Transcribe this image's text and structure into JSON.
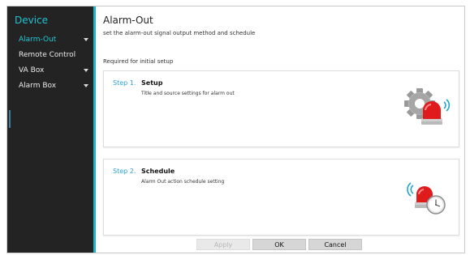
{
  "sidebar": {
    "title": "Device",
    "items": [
      {
        "label": "Alarm-Out",
        "active": true,
        "has_caret": true
      },
      {
        "label": "Remote Control",
        "active": false,
        "has_caret": false
      },
      {
        "label": "VA Box",
        "active": false,
        "has_caret": true
      },
      {
        "label": "Alarm Box",
        "active": false,
        "has_caret": true
      }
    ]
  },
  "header": {
    "title": "Alarm-Out",
    "subtitle": "set the alarm-out signal output method and schedule"
  },
  "section_label": "Required for initial setup",
  "steps": [
    {
      "number": "Step 1.",
      "title": "Setup",
      "description": "Title and source settings for alarm out",
      "icon": "gear-alarm-icon"
    },
    {
      "number": "Step 2.",
      "title": "Schedule",
      "description": "Alarm Out action schedule setting",
      "icon": "alarm-clock-icon"
    }
  ],
  "footer": {
    "apply_label": "Apply",
    "ok_label": "OK",
    "cancel_label": "Cancel"
  },
  "colors": {
    "sidebar_bg": "#232323",
    "accent": "#16b8c9",
    "step_number": "#2a9fd8",
    "alarm_red": "#e01b1b"
  }
}
